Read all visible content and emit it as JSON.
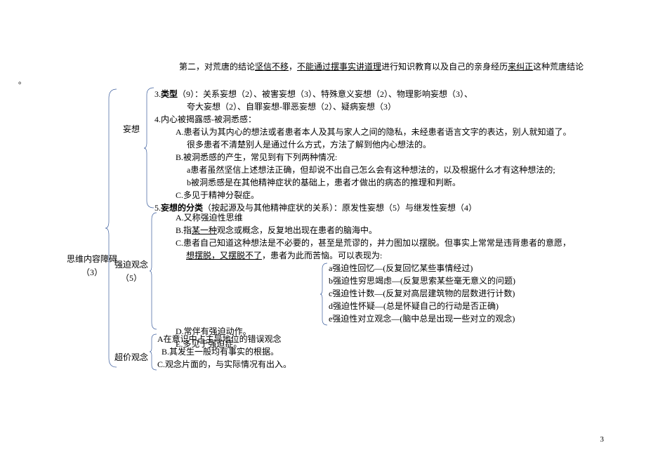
{
  "page_number": "3",
  "top_note": "第二，对荒唐的结论",
  "top_note_u1": "坚信不移",
  "top_note_mid": "，",
  "top_note_u2": "不能通过摆事实讲道理",
  "top_note_end": "进行知识教育以及自己的亲身经历",
  "top_note_u3": "来纠正",
  "top_note_end2": "这种荒唐结论",
  "left_dot": "。",
  "main_label": "思维内容障碍",
  "main_label_num": "（3）",
  "sub1_label": "妄想",
  "sub2_label": "强迫观念",
  "sub2_label_num": "（5）",
  "sub3_label": "超价观念",
  "wangxiang": {
    "line3a": "3.",
    "line3b": "类型",
    "line3c": "（9）：关系妄想（2）、被害妄想（3）、特殊意义妄想（2）、物理影响妄想（3）、",
    "line3d": "夸大妄想（2）、自罪妄想-罪恶妄想（2）、疑病妄想（3）",
    "line4": "4.内心被揭露感-被洞悉感：",
    "line4a": "A.患者认为其内心的想法或者患者本人及其与家人之间的隐私，未经患者语言文字的表达，别人就知道了。",
    "line4a2": "很多患者不清楚别人是通过什么方式，方法了解到他内心想法的。",
    "line4b": "B.被洞悉感的产生，常见到有下列两种情况:",
    "line4b1": "a患者虽然坚信上述想法正确，但却说不出自己怎么会有这种想法的，以及根据什么才有这种想法的;",
    "line4b2": "b被洞悉感是在其他精神症状的基础上，患者才做出的病态的推理和判断。",
    "line4c": "C.多见于精神分裂症。",
    "line5a": "5.",
    "line5b": "妄想的分类",
    "line5c": "（按起源及与其他精神症状的关系）：原发性妄想（5）与继发性妄想（4）"
  },
  "qiangpo": {
    "lineA": "A.又称强迫性思维",
    "lineB_pre": "B.指",
    "lineB_u": "某一种",
    "lineB_post": "观念或概念，反复地出现在患者的脑海中。",
    "lineC": "C.患者自己知道这种想法是不必要的，甚至是荒谬的，并力图加以摆脱。但事实上常常是违背患者的意愿，",
    "lineC2_u": "想摆脱，又摆脱不了",
    "lineC2_post": "，患者为此而苦恼。可以表现为:",
    "sub_a": "a强迫性回忆—(反复回忆某些事情经过)",
    "sub_b": "b强迫性穷思竭虑—(反复思索某些毫无意义的问题)",
    "sub_c": "c强迫性计数—(反复对高层建筑物的层数进行计数)",
    "sub_d": "d强迫性怀疑—(总是怀疑自己的行动是否正确)",
    "sub_e": "e强迫性对立观念—(脑中总是出现一些对立的观念)",
    "lineD": "D.常伴有强迫动作。",
    "lineE": "E.多见于强迫症。"
  },
  "chaoji": {
    "lineA": "A在意识中占主导地位的错误观念",
    "lineB": "B.其发生一般均有事实的根据。",
    "lineC": "C.观念片面的，与实际情况有出入。"
  }
}
